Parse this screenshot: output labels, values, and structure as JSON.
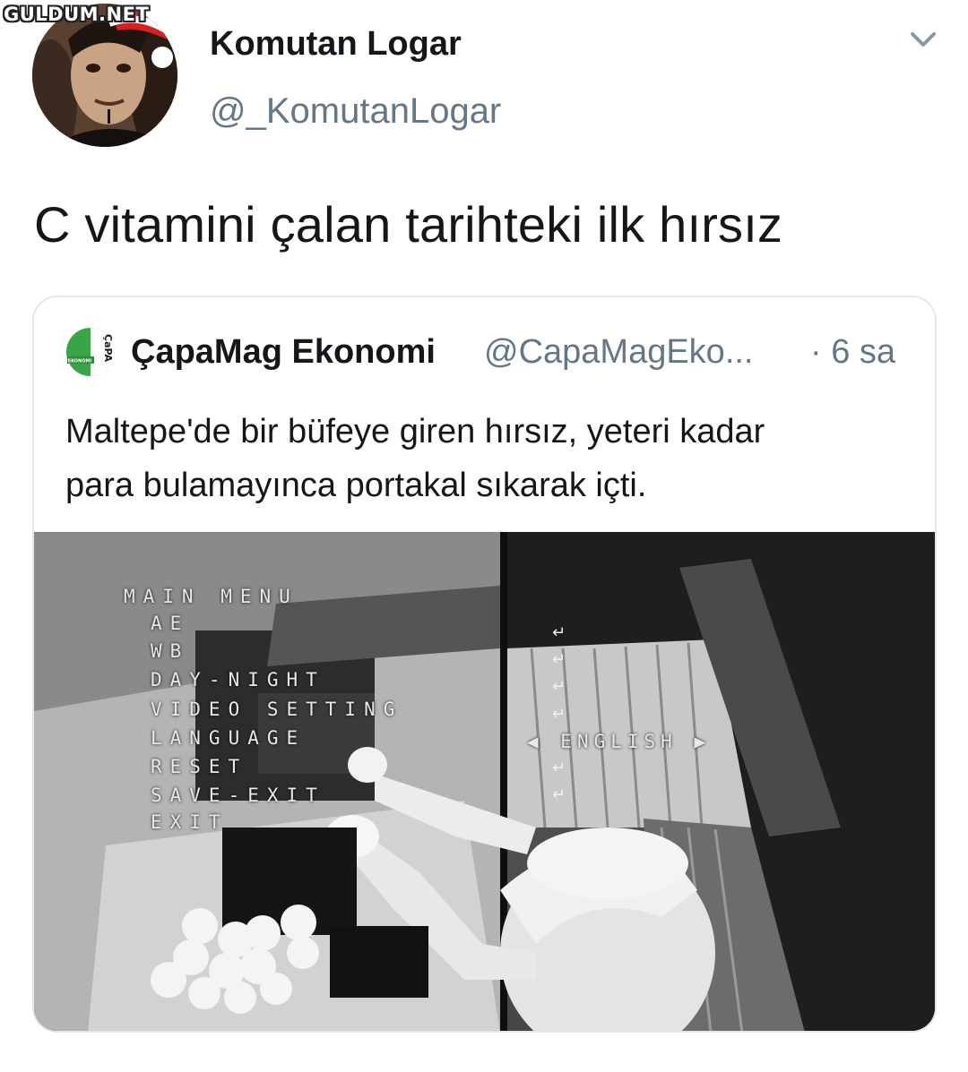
{
  "watermark": "GULDUM.NET",
  "tweet": {
    "display_name": "Komutan Logar",
    "handle": "@_KomutanLogar",
    "text": "C vitamini çalan tarihteki ilk hırsız"
  },
  "quoted_tweet": {
    "avatar_label": "ÇaPA",
    "avatar_sublabel": "EKONOMI",
    "display_name": "ÇapaMag Ekonomi",
    "handle": "@CapaMagEko...",
    "time": "· 6 sa",
    "text_lines": [
      "Maltepe'de bir büfeye giren hırsız, yeteri kadar",
      "para bulamayınca portakal sıkarak içti."
    ],
    "camera_menu": {
      "title": "MAIN MENU",
      "items": [
        "AE",
        "WB",
        "DAY-NIGHT",
        "VIDEO SETTING",
        "LANGUAGE",
        "RESET",
        "SAVE-EXIT",
        "EXIT"
      ],
      "language_value": "ENGLISH"
    }
  },
  "colors": {
    "text_primary": "#14171a",
    "text_secondary": "#657786",
    "border": "#e1e8ed",
    "brand_green": "#3aa546"
  }
}
